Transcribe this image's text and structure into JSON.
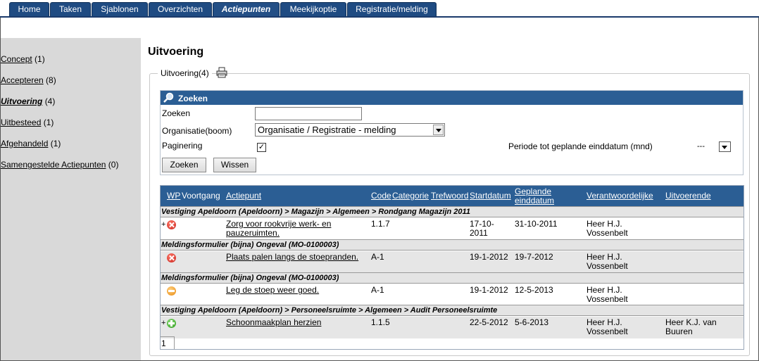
{
  "nav": {
    "tabs": [
      {
        "label": "Home"
      },
      {
        "label": "Taken"
      },
      {
        "label": "Sjablonen"
      },
      {
        "label": "Overzichten"
      },
      {
        "label": "Actiepunten",
        "active": true
      },
      {
        "label": "Meekijkoptie"
      },
      {
        "label": "Registratie/melding"
      }
    ]
  },
  "sidebar": {
    "items": [
      {
        "label": "Concept",
        "count": "(1)"
      },
      {
        "label": "Accepteren",
        "count": "(8)"
      },
      {
        "label": "Uitvoering",
        "count": "(4)",
        "active": true
      },
      {
        "label": "Uitbesteed",
        "count": "(1)"
      },
      {
        "label": "Afgehandeld",
        "count": "(1)"
      },
      {
        "label": "Samengestelde Actiepunten",
        "count": "(0)"
      }
    ]
  },
  "page": {
    "title": "Uitvoering",
    "fieldset_legend": "Uitvoering(4)"
  },
  "search": {
    "header": "Zoeken",
    "zoeken_label": "Zoeken",
    "zoeken_value": "",
    "organisatie_label": "Organisatie(boom)",
    "organisatie_value": "Organisatie / Registratie - melding",
    "paginering_label": "Paginering",
    "paginering_checked": true,
    "periode_label": "Periode tot geplande einddatum (mnd)",
    "periode_value": "---",
    "btn_search": "Zoeken",
    "btn_clear": "Wissen"
  },
  "table": {
    "headers": {
      "wp": "WP",
      "voortgang": "Voortgang",
      "actiepunt": "Actiepunt",
      "code": "Code",
      "categorie": "Categorie",
      "trefwoord": "Trefwoord",
      "startdatum": "Startdatum",
      "geplande1": "Geplande",
      "geplande2": "einddatum",
      "verantwoordelijke": "Verantwoordelijke",
      "uitvoerende": "Uitvoerende"
    },
    "groups": [
      {
        "title": "Vestiging Apeldoorn (Apeldoorn) > Magazijn > Algemeen > Rondgang Magazijn 2011",
        "row": {
          "plus": "+",
          "status": "red",
          "actie1": "Zorg voor rookvrije werk- en",
          "actie2": "pauzeruimten.",
          "code": "1.1.7",
          "start1": "17-10-",
          "start2": "2011",
          "eind": "31-10-2011",
          "verantw1": "Heer H.J.",
          "verantw2": "Vossenbelt",
          "uitv1": "",
          "uitv2": ""
        }
      },
      {
        "title": "Meldingsformulier (bijna) Ongeval (MO-0100003)",
        "row": {
          "plus": "",
          "status": "red",
          "actie1": "Plaats palen langs de stoepranden.",
          "actie2": "",
          "code": "A-1",
          "start1": "19-1-2012",
          "start2": "",
          "eind": "19-7-2012",
          "verantw1": "Heer H.J.",
          "verantw2": "Vossenbelt",
          "uitv1": "",
          "uitv2": ""
        }
      },
      {
        "title": "Meldingsformulier (bijna) Ongeval (MO-0100003)",
        "row": {
          "plus": "",
          "status": "orange",
          "actie1": "Leg de stoep weer goed.",
          "actie2": "",
          "code": "A-1",
          "start1": "19-1-2012",
          "start2": "",
          "eind": "12-5-2013",
          "verantw1": "Heer H.J.",
          "verantw2": "Vossenbelt",
          "uitv1": "",
          "uitv2": ""
        }
      },
      {
        "title": "Vestiging Apeldoorn (Apeldoorn) > Personeelsruimte > Algemeen > Audit Personeelsruimte",
        "row": {
          "plus": "+",
          "status": "green",
          "actie1": "Schoonmaakplan herzien",
          "actie2": "",
          "code": "1.1.5",
          "start1": "22-5-2012",
          "start2": "",
          "eind": "5-6-2013",
          "verantw1": "Heer H.J.",
          "verantw2": "Vossenbelt",
          "uitv1": "Heer K.J. van",
          "uitv2": "Buuren"
        }
      }
    ],
    "page": "1"
  }
}
